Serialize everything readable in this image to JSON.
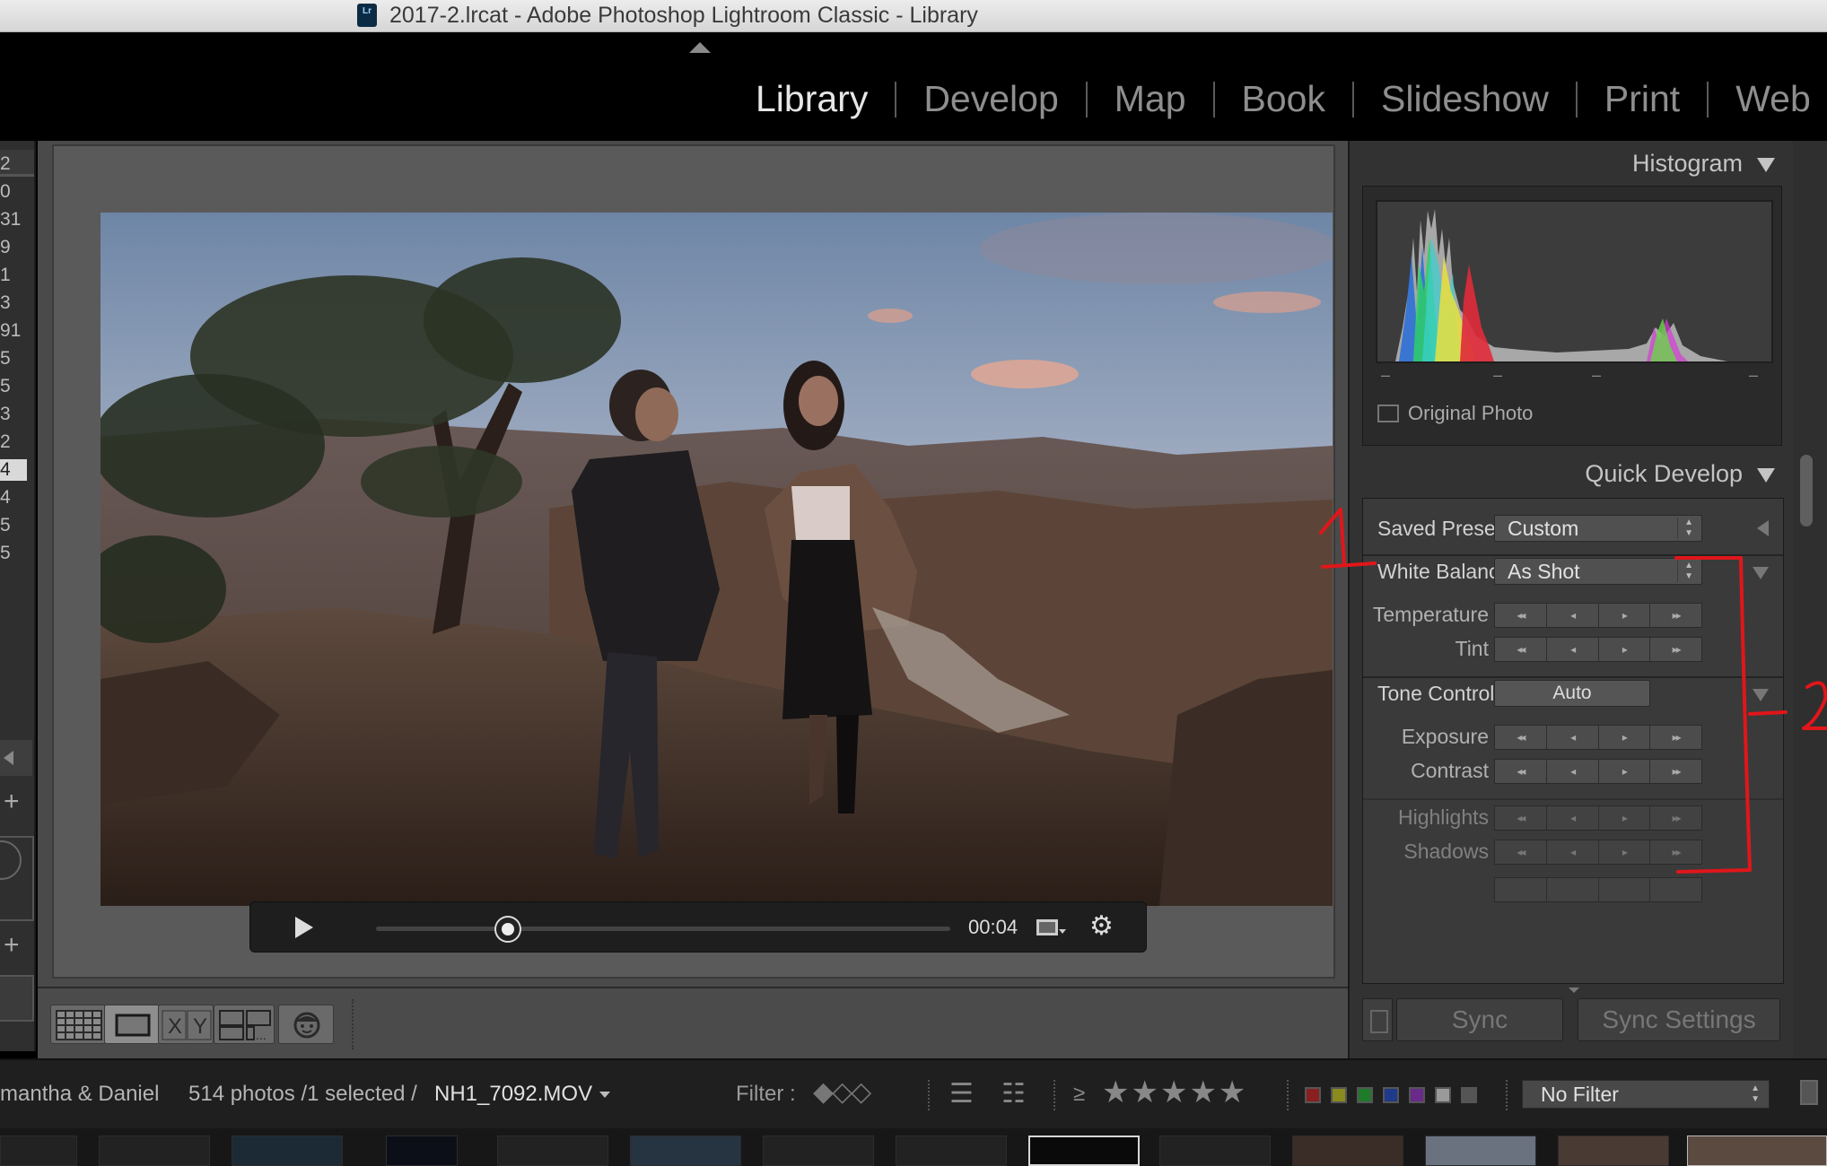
{
  "window": {
    "title": "2017-2.lrcat - Adobe Photoshop Lightroom Classic - Library",
    "badge": "Lr"
  },
  "modules": [
    {
      "label": "Library",
      "active": true
    },
    {
      "label": "Develop",
      "active": false
    },
    {
      "label": "Map",
      "active": false
    },
    {
      "label": "Book",
      "active": false
    },
    {
      "label": "Slideshow",
      "active": false
    },
    {
      "label": "Print",
      "active": false
    },
    {
      "label": "Web",
      "active": false
    }
  ],
  "left_counts": [
    "2",
    "0",
    "31",
    "9",
    "1",
    "3",
    "91",
    "5",
    "5",
    "3",
    "2",
    "4",
    "4",
    "5",
    "5"
  ],
  "left_selected_index": 11,
  "video": {
    "time": "00:04",
    "progress": 0.23
  },
  "right_panel": {
    "histogram": {
      "header": "Histogram",
      "original_photo_label": "Original Photo"
    },
    "quick_develop": {
      "header": "Quick Develop",
      "saved_preset": {
        "label": "Saved Preset",
        "value": "Custom"
      },
      "white_balance": {
        "label": "White Balance",
        "value": "As Shot"
      },
      "temperature": "Temperature",
      "tint": "Tint",
      "tone_control": {
        "label": "Tone Control",
        "button": "Auto"
      },
      "exposure": "Exposure",
      "contrast": "Contrast",
      "highlights": "Highlights",
      "shadows": "Shadows"
    },
    "sync": {
      "sync_label": "Sync",
      "sync_settings_label": "Sync Settings"
    }
  },
  "filter_bar": {
    "collection": "mantha & Daniel",
    "count": "514 photos /1 selected /",
    "filename": "NH1_7092.MOV",
    "filter_label": "Filter :",
    "ge": "≥",
    "stars": "★★★★★",
    "no_filter": "No Filter",
    "label_colors": [
      "#8a1f1f",
      "#8a8a1f",
      "#1f7a2a",
      "#1f3a8a",
      "#6a2a8a",
      "#9a9a9a",
      "#555555"
    ]
  },
  "annotations": {
    "mark1": "1",
    "mark2": "2",
    "color": "#e0161a"
  }
}
